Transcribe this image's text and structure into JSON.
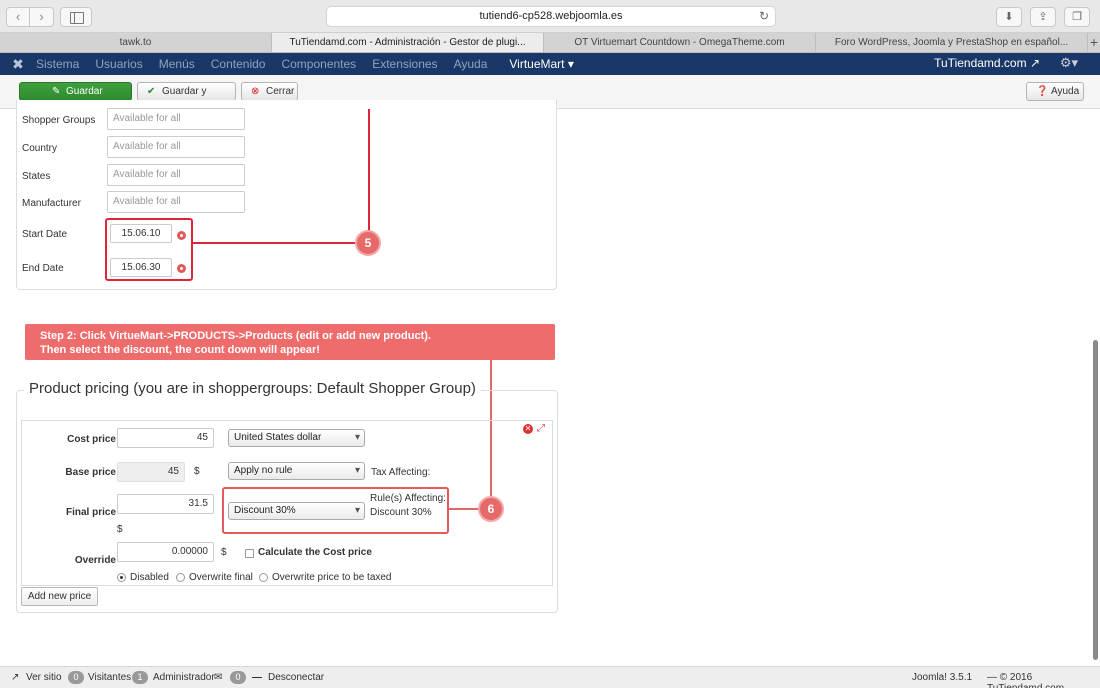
{
  "browser": {
    "url": "tutiend6-cp528.webjoomla.es",
    "tabs": [
      {
        "label": "tawk.to"
      },
      {
        "label": "TuTiendamd.com - Administración - Gestor de plugi..."
      },
      {
        "label": "OT Virtuemart Countdown - OmegaTheme.com"
      },
      {
        "label": "Foro WordPress, Joomla y PrestaShop en español..."
      }
    ]
  },
  "admin_menu": {
    "items": [
      "Sistema",
      "Usuarios",
      "Menús",
      "Contenido",
      "Componentes",
      "Extensiones",
      "Ayuda"
    ],
    "virtuemart": "VirtueMart ▾",
    "site": "TuTiendamd.com ↗"
  },
  "toolbar": {
    "save": "Guardar",
    "save_close": "Guardar y cerrar",
    "close": "Cerrar",
    "help": "Ayuda"
  },
  "rule_form": {
    "shopper_groups_label": "Shopper Groups",
    "shopper_groups_value": "Available for all",
    "country_label": "Country",
    "country_value": "Available for all",
    "states_label": "States",
    "states_value": "Available for all",
    "manufacturer_label": "Manufacturer",
    "manufacturer_value": "Available for all",
    "start_date_label": "Start Date",
    "start_date_value": "15.06.10",
    "end_date_label": "End Date",
    "end_date_value": "15.06.30"
  },
  "annotations": {
    "badge_5": "5",
    "badge_6": "6",
    "step2_line1": "Step 2: Click VirtueMart->PRODUCTS->Products (edit or add new product).",
    "step2_line2": "Then select the discount, the count down will appear!"
  },
  "pricing": {
    "legend": "Product pricing (you are in shoppergroups: Default Shopper Group)",
    "cost_price_label": "Cost price",
    "cost_price_value": "45",
    "currency": "United States dollar",
    "base_price_label": "Base price",
    "base_price_value": "45",
    "dollar": "$",
    "tax_rule": "Apply no rule",
    "tax_affecting": "Tax Affecting:",
    "final_price_label": "Final price",
    "final_price_value": "31.5",
    "discount_rule": "Discount 30%",
    "rules_affecting": "Rule(s) Affecting:",
    "rules_affecting_value": "Discount 30%",
    "override_label": "Override",
    "override_value": "0.00000",
    "calc_cost_label": "Calculate the Cost price",
    "radio_disabled": "Disabled",
    "radio_overwrite_final": "Overwrite final",
    "radio_overwrite_taxed": "Overwrite price to be taxed",
    "add_new_price": "Add new price"
  },
  "status_bar": {
    "view_site": "Ver sitio",
    "visitors_count": "0",
    "visitors": "Visitantes",
    "admin_count": "1",
    "admin": "Administrador",
    "msg_count": "0",
    "logout": "Desconectar",
    "version": "Joomla! 3.5.1",
    "copyright": "— © 2016 TuTiendamd.com"
  },
  "colors": {
    "admin_nav": "#1a3867",
    "save_green": "#2f8a2f",
    "highlight_red": "#e0243a",
    "banner_coral": "#ef6c6c"
  }
}
